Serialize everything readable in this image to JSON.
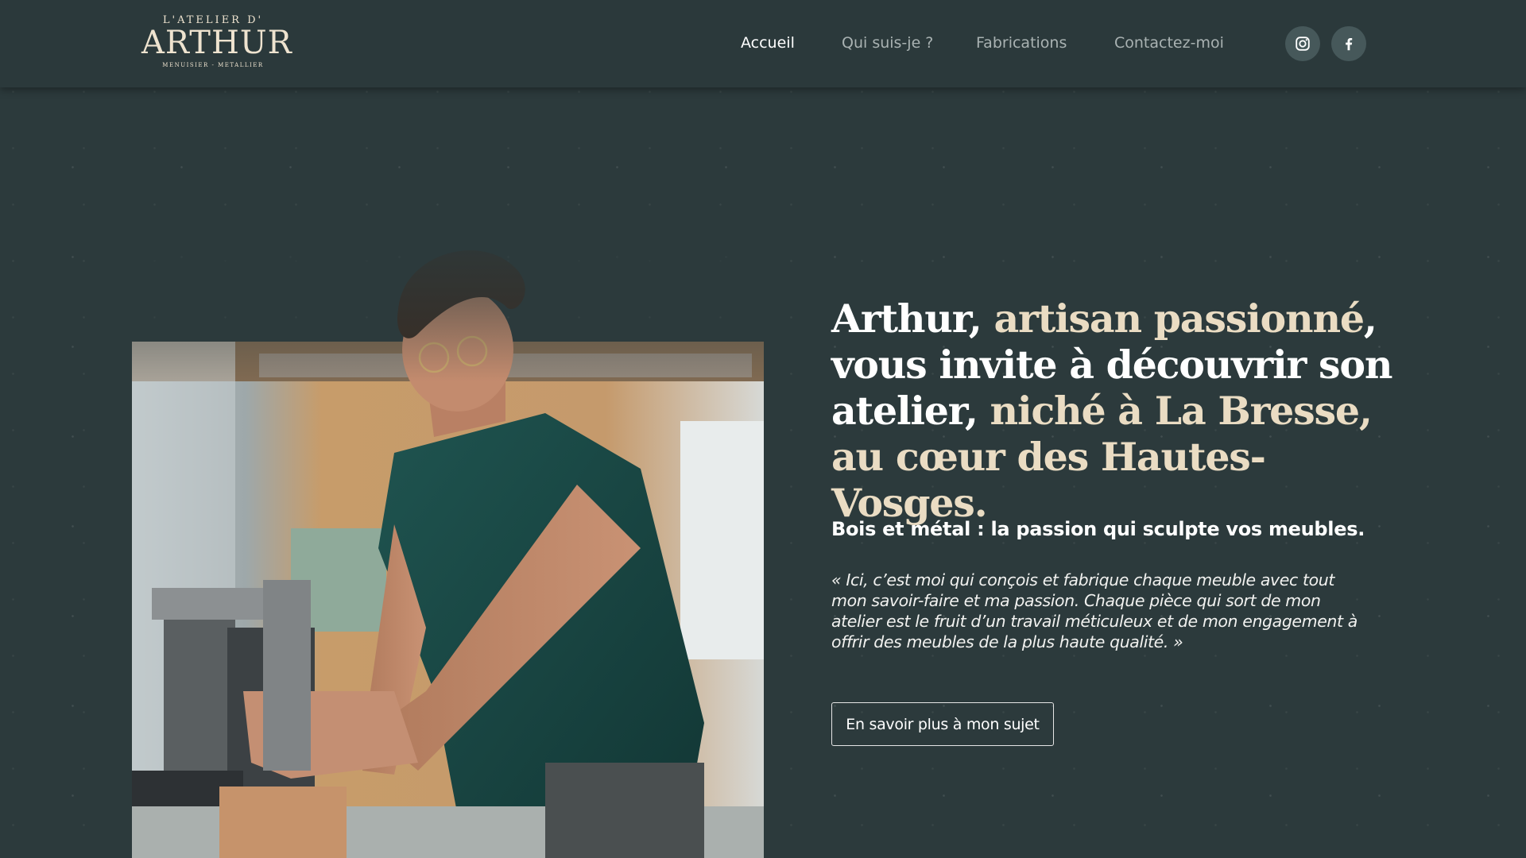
{
  "logo": {
    "top": "L'ATELIER D'",
    "main": "ARTHUR",
    "sub": "MENUISIER - METALLIER"
  },
  "nav": {
    "items": [
      {
        "label": "Accueil",
        "active": true
      },
      {
        "label": "Qui suis-je ?",
        "active": false
      },
      {
        "label": "Fabrications",
        "active": false
      },
      {
        "label": "Contactez-moi",
        "active": false
      }
    ]
  },
  "social": {
    "icons": [
      "instagram-icon",
      "facebook-icon"
    ]
  },
  "hero": {
    "headline": [
      {
        "text": "Arthur, ",
        "accent": false
      },
      {
        "text": "artisan passionné",
        "accent": true
      },
      {
        "text": ", vous invite à découvrir son atelier, ",
        "accent": false
      },
      {
        "text": "niché à La Bresse, au cœur des Hautes-Vosges",
        "accent": true
      },
      {
        "text": ".",
        "accent": false
      }
    ],
    "subheading": "Bois et métal : la passion qui sculpte vos meubles.",
    "quote": "« Ici, c’est moi qui conçois et fabrique chaque meuble avec tout mon savoir-faire et ma passion. Chaque pièce qui sort de mon atelier est le fruit d’un travail méticuleux et de mon engagement à offrir des meubles de la plus haute qualité. »",
    "cta_label": "En savoir plus à mon sujet"
  },
  "colors": {
    "background": "#2c3a3c",
    "accent": "#eadcc3",
    "nav_inactive": "#a9b2b2",
    "social_bg": "#46585a"
  }
}
